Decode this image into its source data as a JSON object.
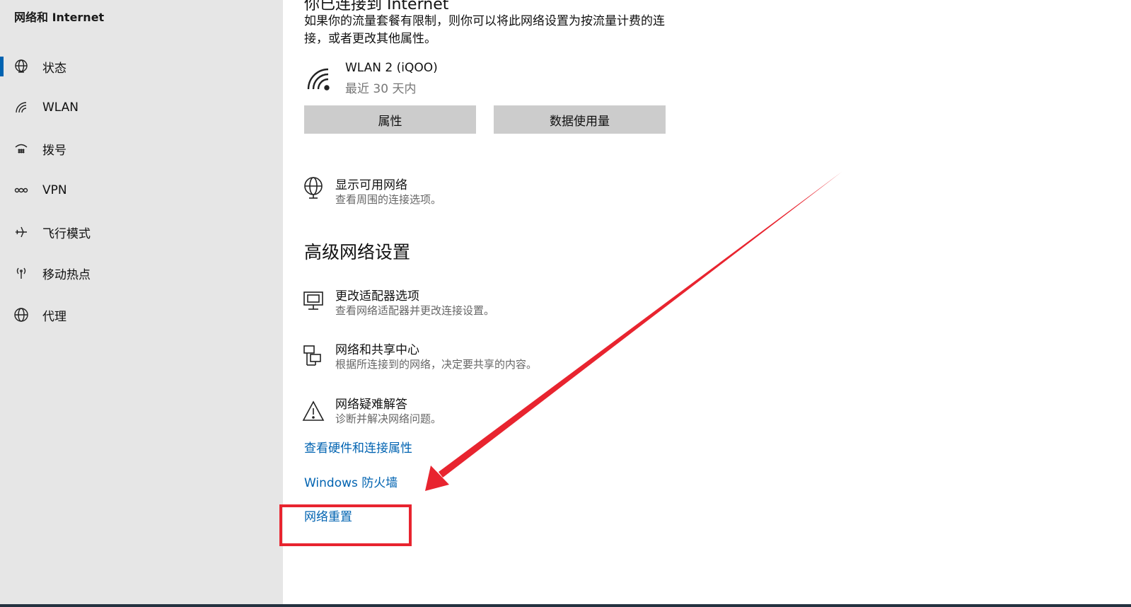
{
  "sidebar": {
    "title": "网络和 Internet",
    "items": [
      {
        "label": "状态",
        "icon": "status-globe-icon",
        "selected": true
      },
      {
        "label": "WLAN",
        "icon": "wifi-icon",
        "selected": false
      },
      {
        "label": "拨号",
        "icon": "dialup-icon",
        "selected": false
      },
      {
        "label": "VPN",
        "icon": "vpn-icon",
        "selected": false
      },
      {
        "label": "飞行模式",
        "icon": "airplane-icon",
        "selected": false
      },
      {
        "label": "移动热点",
        "icon": "hotspot-icon",
        "selected": false
      },
      {
        "label": "代理",
        "icon": "globe-icon",
        "selected": false
      }
    ]
  },
  "main": {
    "connected_heading": "你已连接到 Internet",
    "metered_description": "如果你的流量套餐有限制，则你可以将此网络设置为按流量计费的连接，或者更改其他属性。",
    "network": {
      "name": "WLAN 2 (iQOO)",
      "period": "最近 30 天内",
      "icon": "wifi-signal-icon"
    },
    "buttons": {
      "properties": "属性",
      "data_usage": "数据使用量"
    },
    "show_networks": {
      "title": "显示可用网络",
      "subtitle": "查看周围的连接选项。",
      "icon": "network-globe-icon"
    },
    "advanced_heading": "高级网络设置",
    "advanced_options": [
      {
        "title": "更改适配器选项",
        "subtitle": "查看网络适配器并更改连接设置。",
        "icon": "monitor-icon"
      },
      {
        "title": "网络和共享中心",
        "subtitle": "根据所连接到的网络，决定要共享的内容。",
        "icon": "sharing-center-icon"
      },
      {
        "title": "网络疑难解答",
        "subtitle": "诊断并解决网络问题。",
        "icon": "warning-icon"
      }
    ],
    "links": {
      "hardware": "查看硬件和连接属性",
      "firewall": "Windows 防火墙",
      "reset": "网络重置"
    }
  },
  "colors": {
    "accent": "#0063b1",
    "sidebar_bg": "#e6e6e6",
    "button_bg": "#cccccc",
    "annotation_red": "#e8242f"
  }
}
